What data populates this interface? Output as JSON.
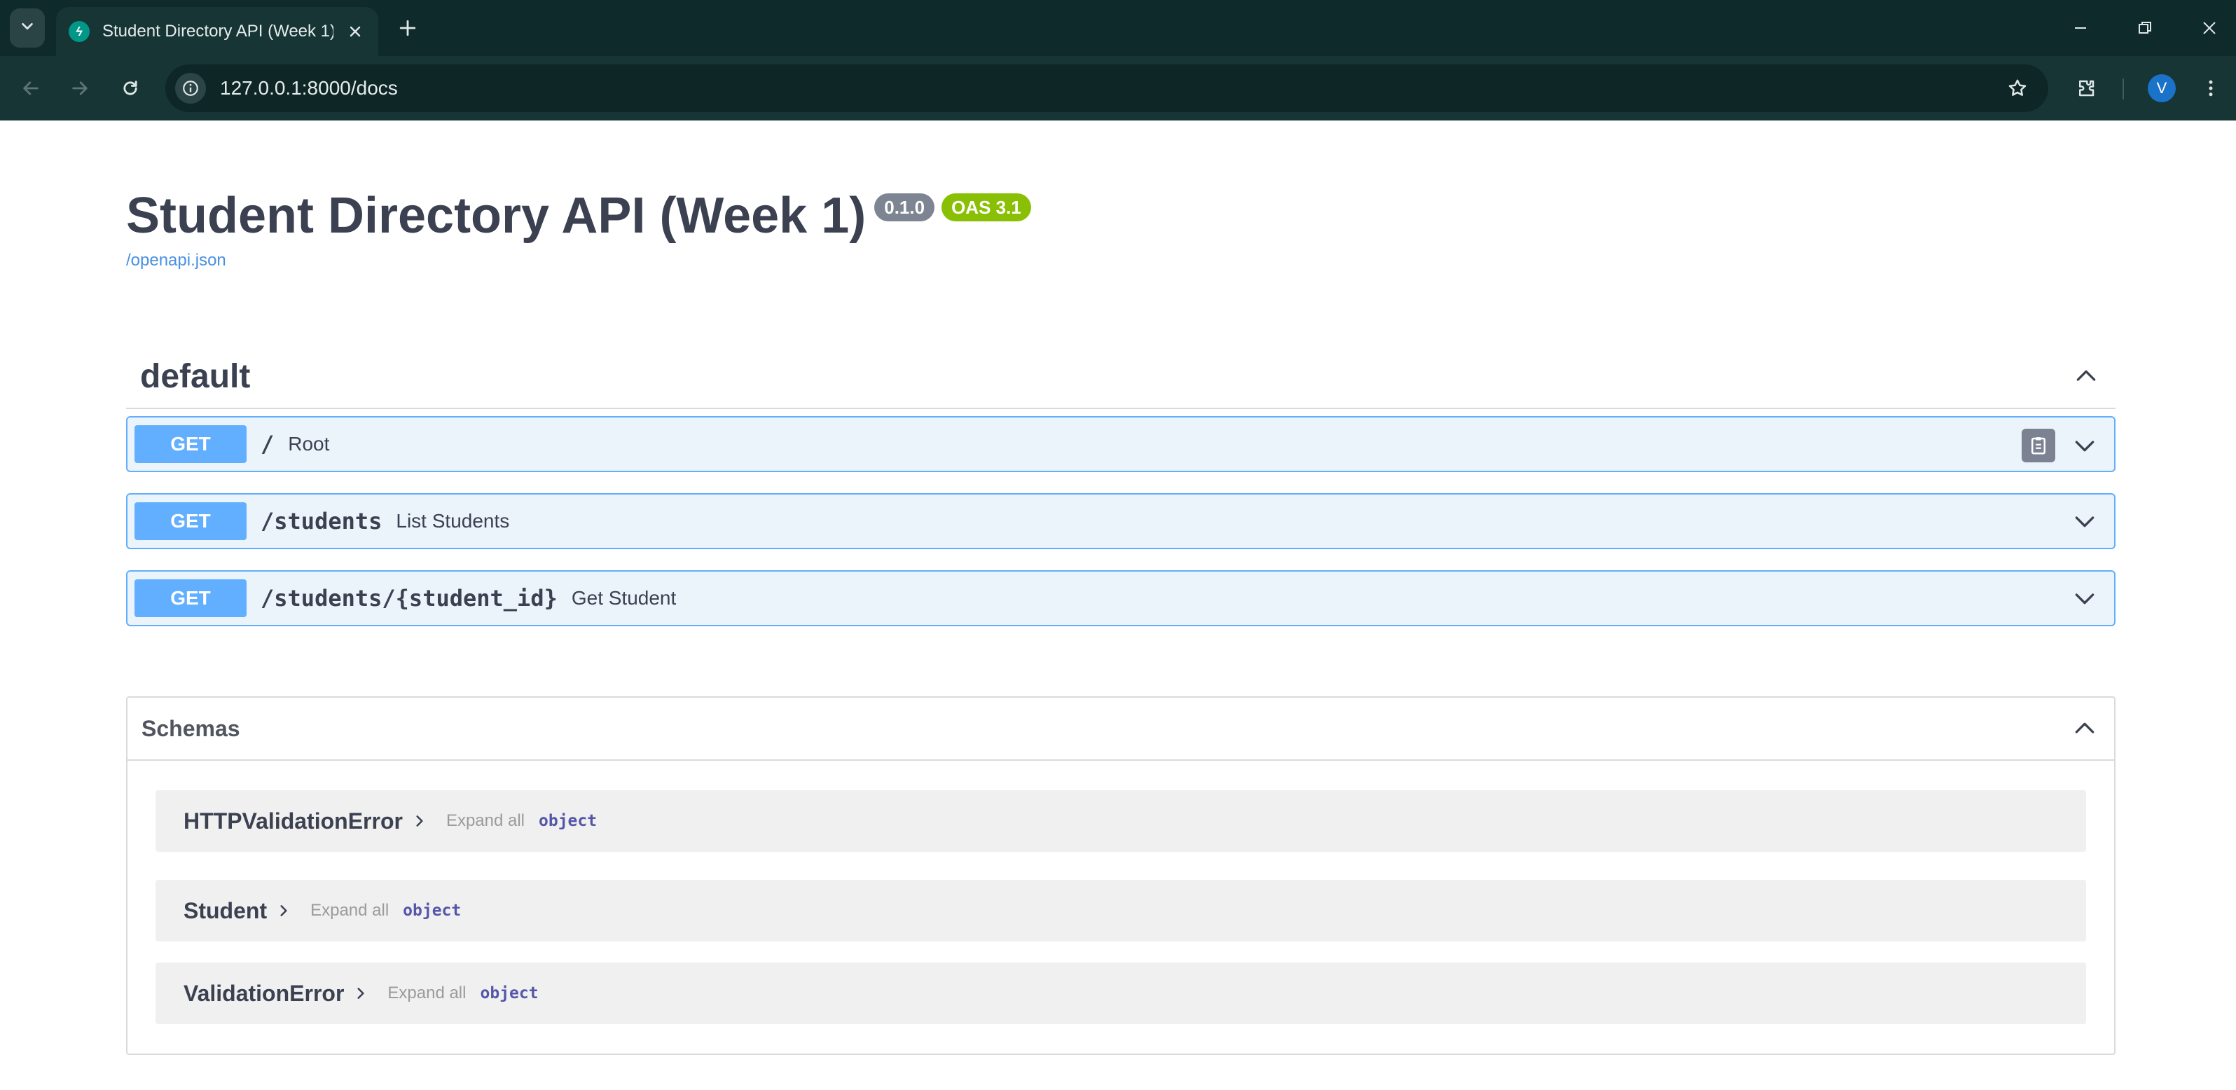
{
  "browser": {
    "tab_title": "Student Directory API (Week 1)",
    "url": "127.0.0.1:8000/docs",
    "profile_initial": "V",
    "icons": {
      "tab_search": "chevron-down-icon",
      "favicon": "fastapi-icon",
      "tab_close": "close-icon",
      "new_tab": "plus-icon",
      "back": "back-arrow-icon",
      "forward": "forward-arrow-icon",
      "reload": "reload-icon",
      "site_info": "info-icon",
      "bookmark": "star-icon",
      "extensions": "puzzle-icon",
      "menu": "more-vert-icon",
      "minimize": "minimize-icon",
      "restore": "restore-icon",
      "close_window": "close-icon"
    }
  },
  "info": {
    "title": "Student Directory API (Week 1)",
    "version": "0.1.0",
    "oas": "OAS 3.1",
    "spec_link": "/openapi.json"
  },
  "tag": {
    "name": "default",
    "operations": [
      {
        "method": "GET",
        "path": "/",
        "summary": "Root"
      },
      {
        "method": "GET",
        "path": "/students",
        "summary": "List Students"
      },
      {
        "method": "GET",
        "path": "/students/{student_id}",
        "summary": "Get Student"
      }
    ]
  },
  "schemas": {
    "title": "Schemas",
    "models": [
      {
        "name": "HTTPValidationError",
        "expand_label": "Expand all",
        "type": "object"
      },
      {
        "name": "Student",
        "expand_label": "Expand all",
        "type": "object"
      },
      {
        "name": "ValidationError",
        "expand_label": "Expand all",
        "type": "object"
      }
    ]
  },
  "colors": {
    "get_method": "#61affe",
    "get_background": "#ebf3fb",
    "oas_badge": "#89bf04",
    "version_badge": "#7d8492",
    "link": "#4990e2",
    "chrome_dark": "#0e2a2a"
  }
}
